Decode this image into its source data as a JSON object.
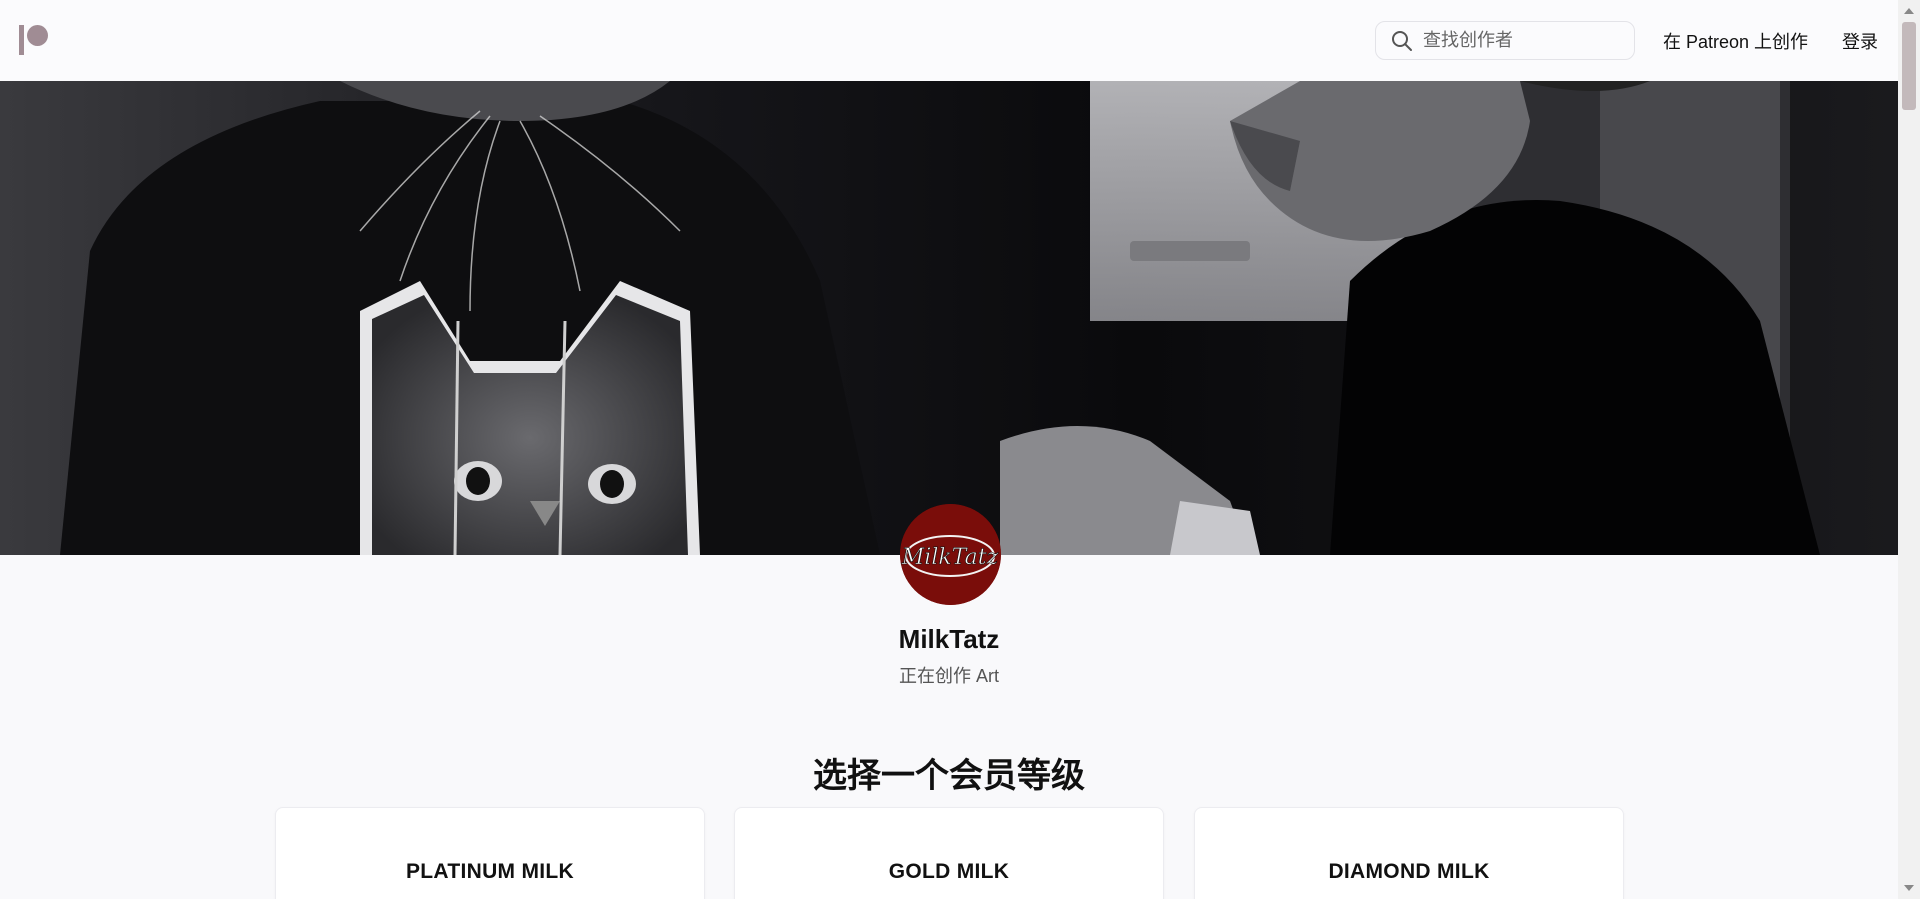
{
  "header": {
    "search_placeholder": "查找创作者",
    "create_link": "在 Patreon 上创作",
    "login_link": "登录"
  },
  "creator": {
    "name": "MilkTatz",
    "tagline": "正在创作 Art",
    "avatar_text": "MilkTatz"
  },
  "tiers": {
    "heading": "选择一个会员等级",
    "items": [
      {
        "name": "PLATINUM MILK"
      },
      {
        "name": "GOLD MILK"
      },
      {
        "name": "DIAMOND MILK"
      }
    ]
  },
  "colors": {
    "brand": "#a08c94",
    "avatar_bg": "#7a0d0a",
    "page_bg": "#f9f9fb"
  }
}
